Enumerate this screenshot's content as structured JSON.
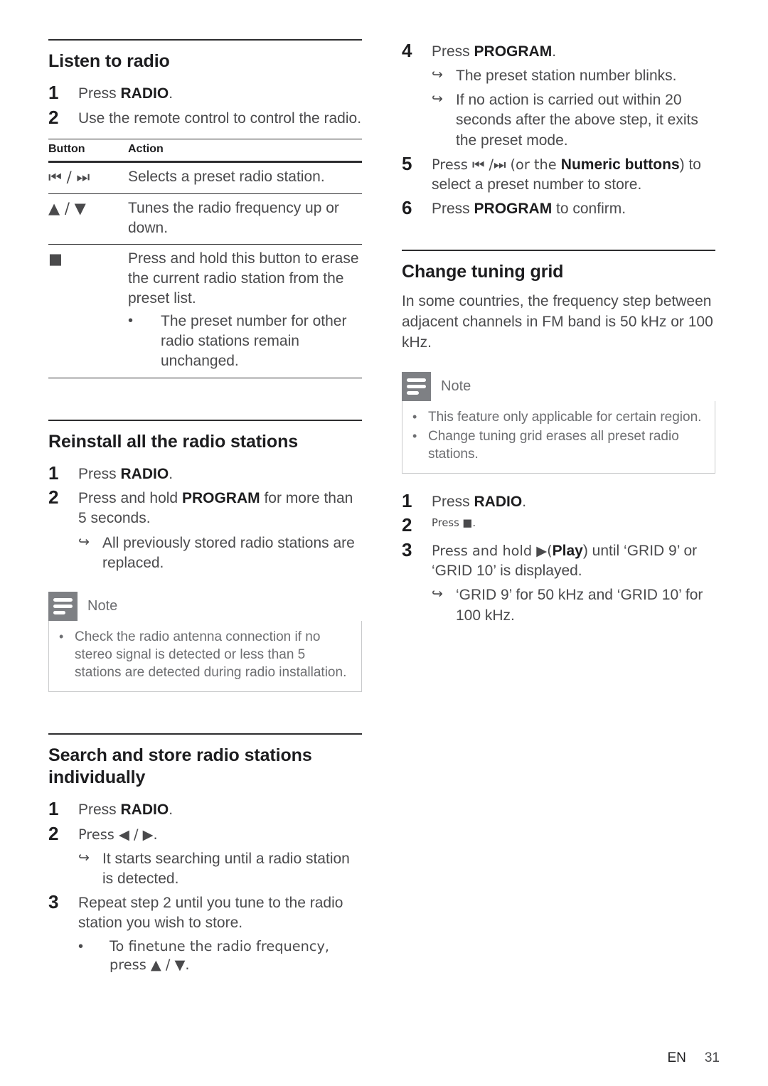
{
  "page": {
    "footer_lang": "EN",
    "footer_page": "31"
  },
  "left": {
    "listen": {
      "heading": "Listen to radio",
      "steps": [
        {
          "num": "1",
          "pre": "Press ",
          "bold": "RADIO",
          "post": "."
        },
        {
          "num": "2",
          "pre": "Use the remote control to control the radio.",
          "bold": "",
          "post": ""
        }
      ],
      "table": {
        "headers": [
          "Button",
          "Action"
        ],
        "rows": [
          {
            "button": "⏮ / ⏭",
            "action": "Selects a preset radio station.",
            "bullets": []
          },
          {
            "button": "▲ / ▼",
            "action": "Tunes the radio frequency up or down.",
            "bullets": []
          },
          {
            "button": "■",
            "action": "Press and hold this button to erase the current radio station from the preset list.",
            "bullets": [
              "The preset number for other radio stations remain unchanged."
            ]
          }
        ]
      }
    },
    "reinstall": {
      "heading": "Reinstall all the radio stations",
      "steps": [
        {
          "num": "1",
          "pre": "Press ",
          "bold": "RADIO",
          "post": "."
        },
        {
          "num": "2",
          "pre": "Press and hold ",
          "bold": "PROGRAM",
          "post": " for more than 5 seconds."
        }
      ],
      "results": [
        "All previously stored radio stations are replaced."
      ],
      "note": {
        "title": "Note",
        "items": [
          "Check the radio antenna connection if no stereo signal is detected or less than 5 stations are detected during radio installation."
        ]
      }
    },
    "search": {
      "heading": "Search and store radio stations individually",
      "steps": [
        {
          "num": "1",
          "pre": "Press ",
          "bold": "RADIO",
          "post": "."
        },
        {
          "num": "2",
          "pre": "Press ◀ / ▶.",
          "bold": "",
          "post": ""
        }
      ],
      "step2_results": [
        "It starts searching until a radio station is detected."
      ],
      "step3": {
        "num": "3",
        "text": "Repeat step 2 until you tune to the radio station you wish to store."
      },
      "step3_bullets": [
        "To finetune the radio frequency, press ▲ / ▼."
      ]
    }
  },
  "right": {
    "store_cont": {
      "step4": {
        "num": "4",
        "pre": "Press ",
        "bold": "PROGRAM",
        "post": "."
      },
      "step4_results": [
        "The preset station number blinks.",
        "If no action is carried out within 20 seconds after the above step, it exits the preset mode."
      ],
      "step5": {
        "num": "5",
        "pre": "Press ⏮ /⏭ (or the ",
        "bold": "Numeric buttons",
        "post": ") to select a preset number to store."
      },
      "step6": {
        "num": "6",
        "pre": "Press ",
        "bold": "PROGRAM",
        "post": " to confirm."
      }
    },
    "grid": {
      "heading": "Change tuning grid",
      "paragraph": "In some countries, the frequency step between adjacent channels in FM band is 50 kHz or 100 kHz.",
      "note": {
        "title": "Note",
        "items": [
          "This feature only applicable for certain region.",
          "Change tuning grid erases all preset radio stations."
        ]
      },
      "steps": [
        {
          "num": "1",
          "pre": "Press ",
          "bold": "RADIO",
          "post": "."
        },
        {
          "num": "2",
          "pre": "Press ■.",
          "bold": "",
          "post": ""
        },
        {
          "num": "3",
          "pre": "Press and hold ▶(",
          "bold": "Play",
          "post": ") until ‘GRID 9’ or ‘GRID 10’ is displayed."
        }
      ],
      "results": [
        "‘GRID 9’ for 50 kHz and ‘GRID 10’ for 100 kHz."
      ]
    }
  }
}
